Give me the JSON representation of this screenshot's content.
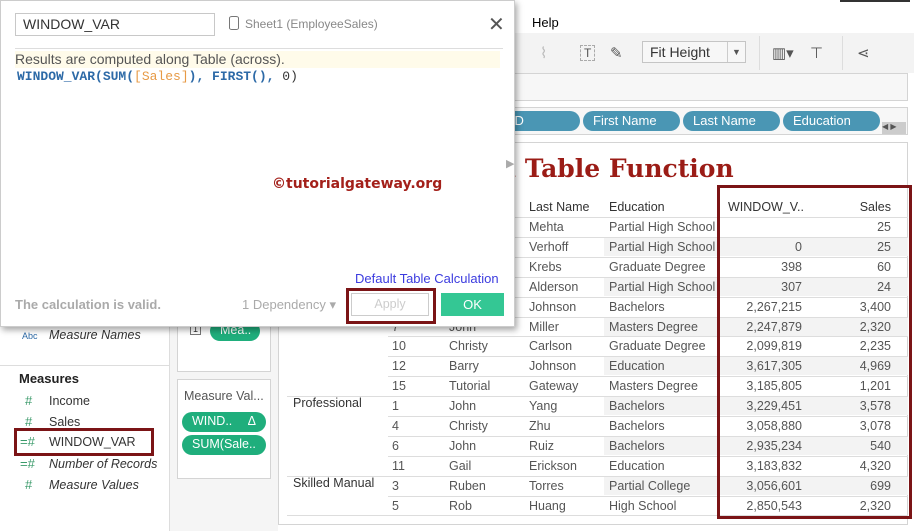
{
  "menu": {
    "help": "Help"
  },
  "toolbar": {
    "fit": "Fit Height"
  },
  "columns_shelf": {
    "pills": [
      "p ID",
      "First Name",
      "Last Name",
      "Education"
    ]
  },
  "sheet": {
    "title": "u Table Function"
  },
  "table": {
    "headers": {
      "last_name": "Last Name",
      "education": "Education",
      "window_var": "WINDOW_V..",
      "sales": "Sales"
    },
    "rows": [
      {
        "group": "",
        "id": "",
        "first": "",
        "last": "Mehta",
        "edu": "Partial High School",
        "wv": "",
        "sales": "25"
      },
      {
        "group": "",
        "id": "",
        "first": "",
        "last": "Verhoff",
        "edu": "Partial High School",
        "wv": "0",
        "sales": "25"
      },
      {
        "group": "",
        "id": "",
        "first": "",
        "last": "Krebs",
        "edu": "Graduate Degree",
        "wv": "398",
        "sales": "60"
      },
      {
        "group": "",
        "id": "",
        "first": "",
        "last": "Alderson",
        "edu": "Partial High School",
        "wv": "307",
        "sales": "24"
      },
      {
        "group": "",
        "id": "",
        "first": "",
        "last": "Johnson",
        "edu": "Bachelors",
        "wv": "2,267,215",
        "sales": "3,400"
      },
      {
        "group": "",
        "id": "7",
        "first": "John",
        "last": "Miller",
        "edu": "Masters Degree",
        "wv": "2,247,879",
        "sales": "2,320"
      },
      {
        "group": "",
        "id": "10",
        "first": "Christy",
        "last": "Carlson",
        "edu": "Graduate Degree",
        "wv": "2,099,819",
        "sales": "2,235"
      },
      {
        "group": "",
        "id": "12",
        "first": "Barry",
        "last": "Johnson",
        "edu": "Education",
        "wv": "3,617,305",
        "sales": "4,969"
      },
      {
        "group": "",
        "id": "15",
        "first": "Tutorial",
        "last": "Gateway",
        "edu": "Masters Degree",
        "wv": "3,185,805",
        "sales": "1,201"
      },
      {
        "group": "Professional",
        "id": "1",
        "first": "John",
        "last": "Yang",
        "edu": "Bachelors",
        "wv": "3,229,451",
        "sales": "3,578"
      },
      {
        "group": "",
        "id": "4",
        "first": "Christy",
        "last": "Zhu",
        "edu": "Bachelors",
        "wv": "3,058,880",
        "sales": "3,078"
      },
      {
        "group": "",
        "id": "6",
        "first": "John",
        "last": "Ruiz",
        "edu": "Bachelors",
        "wv": "2,935,234",
        "sales": "540"
      },
      {
        "group": "",
        "id": "11",
        "first": "Gail",
        "last": "Erickson",
        "edu": "Education",
        "wv": "3,183,832",
        "sales": "4,320"
      },
      {
        "group": "Skilled Manual",
        "id": "3",
        "first": "Ruben",
        "last": "Torres",
        "edu": "Partial College",
        "wv": "3,056,601",
        "sales": "699"
      },
      {
        "group": "",
        "id": "5",
        "first": "Rob",
        "last": "Huang",
        "edu": "High School",
        "wv": "2,850,543",
        "sales": "2,320"
      }
    ]
  },
  "data_pane": {
    "measure_names": "Measure Names",
    "abc": "Abc",
    "measures_heading": "Measures",
    "measures": [
      "Income",
      "Sales",
      "WINDOW_VAR",
      "Number of Records",
      "Measure Values"
    ]
  },
  "cards": {
    "marks_pill": "Mea..",
    "measure_values_title": "Measure Val...",
    "pills": [
      "WIND..",
      "SUM(Sale.."
    ],
    "delta": "Δ"
  },
  "dialog": {
    "name": "WINDOW_VAR",
    "datasource": "Sheet1 (EmployeeSales)",
    "note": "Results are computed along Table (across).",
    "formula": {
      "fn": "WINDOW_VAR(SUM(",
      "field": "[Sales]",
      "mid": "), FIRST(), ",
      "zero": "0",
      ")": ")"
    },
    "watermark": "©tutorialgateway.org",
    "default_link": "Default Table Calculation",
    "status": "The calculation is valid.",
    "dependency": "1 Dependency ▾",
    "apply": "Apply",
    "ok": "OK"
  },
  "colors": {
    "accent_pill": "#4a96b4",
    "green": "#34c794",
    "highlight": "#7b1416",
    "title": "#9b1c16"
  }
}
